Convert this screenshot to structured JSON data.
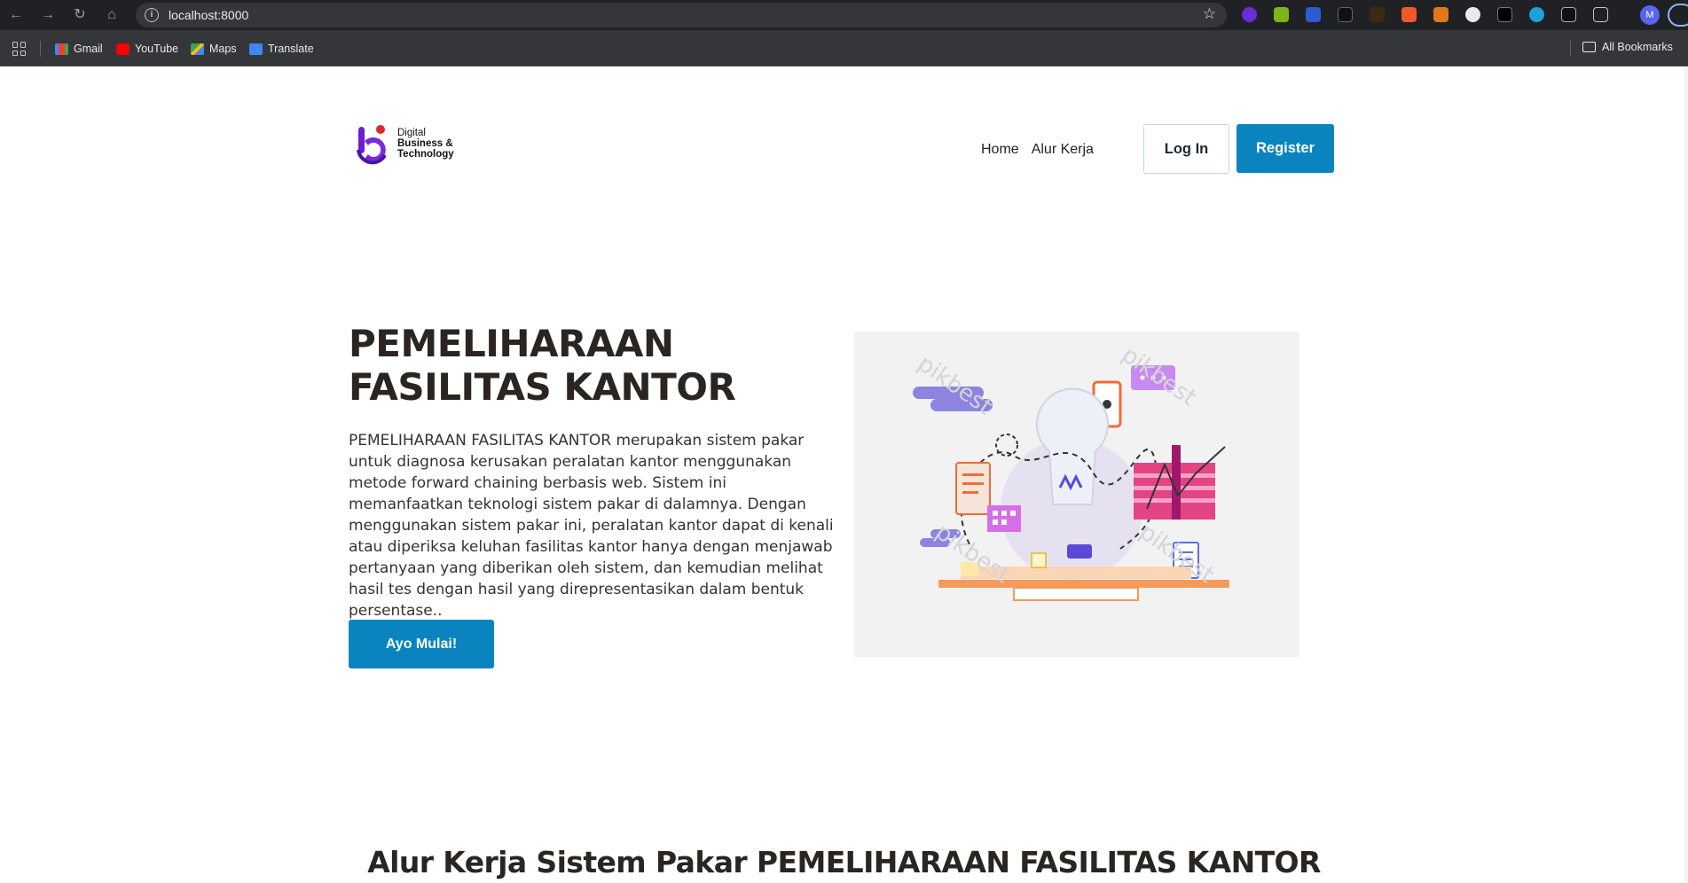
{
  "browser": {
    "url": "localhost:8000",
    "bookmarks": [
      {
        "label": "Gmail",
        "icon": "gmail-icon"
      },
      {
        "label": "YouTube",
        "icon": "youtube-icon"
      },
      {
        "label": "Maps",
        "icon": "maps-icon"
      },
      {
        "label": "Translate",
        "icon": "translate-icon"
      }
    ],
    "all_bookmarks_label": "All Bookmarks",
    "profile_initial": "M"
  },
  "header": {
    "logo": {
      "line1": "Digital",
      "line2": "Business &",
      "line3": "Technology"
    },
    "nav": [
      {
        "label": "Home"
      },
      {
        "label": "Alur Kerja"
      }
    ],
    "login_label": "Log In",
    "register_label": "Register"
  },
  "hero": {
    "title": "PEMELIHARAAN FASILITAS KANTOR",
    "description": "PEMELIHARAAN FASILITAS KANTOR merupakan sistem pakar untuk diagnosa kerusakan peralatan kantor menggunakan metode forward chaining berbasis web. Sistem ini memanfaatkan teknologi sistem pakar di dalamnya. Dengan menggunakan sistem pakar ini, peralatan kantor dapat di kenali atau diperiksa keluhan fasilitas kantor hanya dengan menjawab pertanyaan yang diberikan oleh sistem, dan kemudian melihat hasil tes dengan hasil yang direpresentasikan dalam bentuk persentase..",
    "cta_label": "Ayo Mulai!"
  },
  "section": {
    "title": "Alur Kerja Sistem Pakar PEMELIHARAAN FASILITAS KANTOR"
  },
  "colors": {
    "primary": "#0a84bf",
    "heading": "#2a2520",
    "logo_purple": "#6a1fd0",
    "logo_red": "#e3262e"
  }
}
